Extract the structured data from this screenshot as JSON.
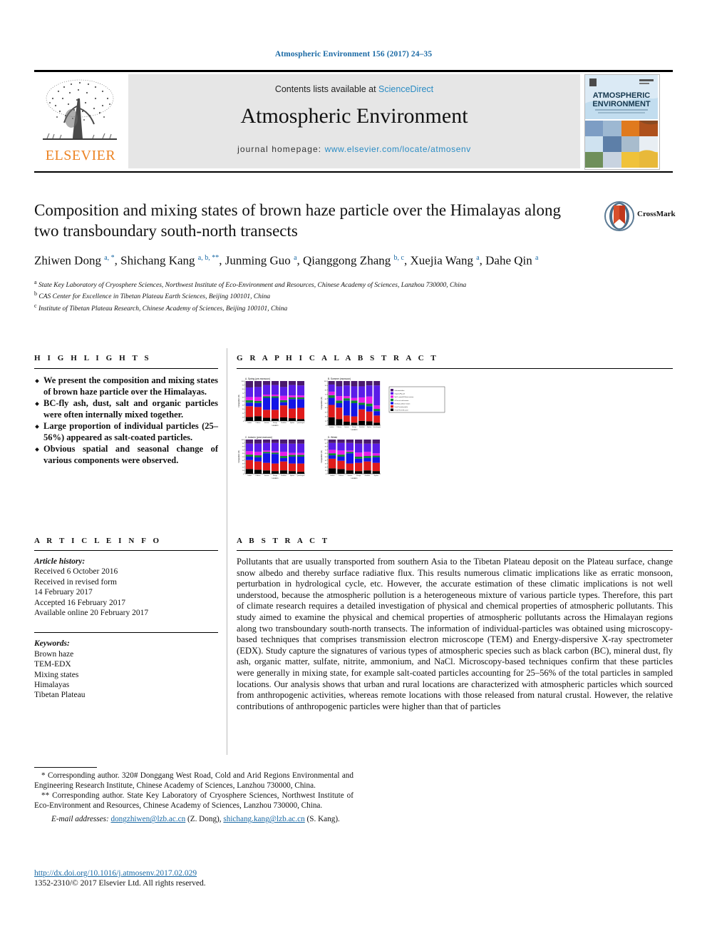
{
  "running_head": "Atmospheric Environment 156 (2017) 24–35",
  "masthead": {
    "contents_line_prefix": "Contents lists available at ",
    "sciencedirect": "ScienceDirect",
    "journal_title": "Atmospheric Environment",
    "homepage_label": "journal homepage:",
    "homepage_url": "www.elsevier.com/locate/atmosenv",
    "publisher": "ELSEVIER",
    "cover_title_line1": "ATMOSPHERIC",
    "cover_title_line2": "ENVIRONMENT"
  },
  "article": {
    "title": "Composition and mixing states of brown haze particle over the Himalayas along two transboundary south-north transects",
    "crossmark_label": "CrossMark",
    "authors_html": "Zhiwen Dong <sup class=\"aff-mark\">a, *</sup>, Shichang Kang <sup class=\"aff-mark\">a, b, **</sup>, Junming Guo <sup class=\"aff-mark\">a</sup>, Qianggong Zhang <sup class=\"aff-mark\">b, c</sup>, Xuejia Wang <sup class=\"aff-mark\">a</sup>, Dahe Qin <sup class=\"aff-mark\">a</sup>",
    "affiliations": [
      {
        "mark": "a",
        "text": "State Key Laboratory of Cryosphere Sciences, Northwest Institute of Eco-Environment and Resources, Chinese Academy of Sciences, Lanzhou 730000, China"
      },
      {
        "mark": "b",
        "text": "CAS Center for Excellence in Tibetan Plateau Earth Sciences, Beijing 100101, China"
      },
      {
        "mark": "c",
        "text": "Institute of Tibetan Plateau Research, Chinese Academy of Sciences, Beijing 100101, China"
      }
    ]
  },
  "highlights": {
    "heading": "H I G H L I G H T S",
    "items": [
      "We present the composition and mixing states of brown haze particle over the Himalayas.",
      "BC-fly ash, dust, salt and organic particles were often internally mixed together.",
      "Large proportion of individual particles (25–56%) appeared as salt-coated particles.",
      "Obvious spatial and seasonal change of various components were observed."
    ]
  },
  "graphical_abstract": {
    "heading": "G R A P H I C A L   A B S T R A C T"
  },
  "article_info": {
    "heading": "A R T I C L E   I N F O",
    "history_label": "Article history:",
    "history": [
      "Received 6 October 2016",
      "Received in revised form",
      "14 February 2017",
      "Accepted 16 February 2017",
      "Available online 20 February 2017"
    ],
    "keywords_label": "Keywords:",
    "keywords": [
      "Brown haze",
      "TEM-EDX",
      "Mixing states",
      "Himalayas",
      "Tibetan Plateau"
    ]
  },
  "abstract": {
    "heading": "A B S T R A C T",
    "text": "Pollutants that are usually transported from southern Asia to the Tibetan Plateau deposit on the Plateau surface, change snow albedo and thereby surface radiative flux. This results numerous climatic implications like as erratic monsoon, perturbation in hydrological cycle, etc. However, the accurate estimation of these climatic implications is not well understood, because the atmospheric pollution is a heterogeneous mixture of various particle types. Therefore, this part of climate research requires a detailed investigation of physical and chemical properties of atmospheric pollutants. This study aimed to examine the physical and chemical properties of atmospheric pollutants across the Himalayan regions along two transboundary south-north transects. The information of individual-particles was obtained using microscopy-based techniques that comprises transmission electron microscope (TEM) and Energy-dispersive X-ray spectrometer (EDX). Study capture the signatures of various types of atmospheric species such as black carbon (BC), mineral dust, fly ash, organic matter, sulfate, nitrite, ammonium, and NaCl. Microscopy-based techniques confirm that these particles were generally in mixing state, for example salt-coated particles accounting for 25–56% of the total particles in sampled locations. Our analysis shows that urban and rural locations are characterized with atmospheric particles which sourced from anthropogenic activities, whereas remote locations with those released from natural crustal. However, the relative contributions of anthropogenic particles were higher than that of particles"
  },
  "footnotes": {
    "note1": "* Corresponding author. 320# Donggang West Road, Cold and Arid Regions Environmental and Engineering Research Institute, Chinese Academy of Sciences, Lanzhou 730000, China.",
    "note2": "** Corresponding author. State Key Laboratory of Cryosphere Sciences, Northwest Institute of Eco-Environment and Resources, Chinese Academy of Sciences, Lanzhou 730000, China.",
    "email_label": "E-mail addresses:",
    "email1": "dongzhiwen@lzb.ac.cn",
    "email1_attrib": "(Z. Dong),",
    "email2": "shichang.kang@lzb.ac.cn",
    "email2_attrib": "(S. Kang)."
  },
  "doi_block": {
    "doi": "http://dx.doi.org/10.1016/j.atmosenv.2017.02.029",
    "copyright": "1352-2310/© 2017 Elsevier Ltd. All rights reserved."
  },
  "colors": {
    "link_blue": "#2b8cc4",
    "head_blue": "#1b6aa5",
    "elsevier_orange": "#ec8424",
    "band_grey": "#e6e6e6"
  },
  "chart_data": [
    {
      "type": "bar",
      "id": "panel-a",
      "title": "A. Spring (pre-monsoon)",
      "xlabel": "Location",
      "ylabel": "Composition (%)",
      "ylim": [
        0,
        100
      ],
      "categories": [
        "Lumbini",
        "Pokhara",
        "Jomsom",
        "Dhunge",
        "Dhulikhel",
        "Nyalam",
        "Qomolangma"
      ],
      "series": [
        {
          "name": "Fresh/Thick BC-soot",
          "color": "#000000",
          "values": [
            10,
            12,
            8,
            6,
            9,
            7,
            5
          ]
        },
        {
          "name": "Dust/Crustal particle",
          "color": "#e01b1b",
          "values": [
            27,
            23,
            20,
            22,
            30,
            24,
            28
          ]
        },
        {
          "name": "BC/Soot-sulfate mixture",
          "color": "#1414e6",
          "values": [
            9,
            10,
            30,
            30,
            8,
            24,
            22
          ]
        },
        {
          "name": "K/Ca-rich salt mixture",
          "color": "#0d8a2e",
          "values": [
            6,
            5,
            4,
            4,
            5,
            4,
            4
          ]
        },
        {
          "name": "NaCl coated BC/dust",
          "color": "#e81ce8",
          "values": [
            8,
            10,
            4,
            4,
            11,
            5,
            5
          ]
        },
        {
          "name": "Organic/Fly-ash",
          "color": "#5a1ce8",
          "values": [
            24,
            25,
            24,
            24,
            22,
            26,
            25
          ]
        },
        {
          "name": "Unknown/other",
          "color": "#4b1a6e",
          "values": [
            16,
            15,
            10,
            10,
            15,
            10,
            11
          ]
        }
      ]
    },
    {
      "type": "bar",
      "id": "panel-b",
      "title": "B. Summer (monsoon)",
      "xlabel": "Location",
      "ylabel": "Composition (%)",
      "ylim": [
        0,
        100
      ],
      "categories": [
        "Lumbini",
        "Pokhara",
        "Jomsom",
        "Dhunge",
        "Dhulikhel",
        "Nyalam",
        "Qomolangma"
      ],
      "series": [
        {
          "name": "Fresh/Thick BC-soot",
          "color": "#000000",
          "values": [
            18,
            14,
            8,
            6,
            10,
            9,
            6
          ]
        },
        {
          "name": "Dust/Crustal particle",
          "color": "#e01b1b",
          "values": [
            28,
            26,
            14,
            14,
            26,
            22,
            16
          ]
        },
        {
          "name": "BC/Soot-sulfate mixture",
          "color": "#1414e6",
          "values": [
            16,
            10,
            34,
            30,
            10,
            12,
            10
          ]
        },
        {
          "name": "K/Ca-rich salt mixture",
          "color": "#0d8a2e",
          "values": [
            6,
            6,
            5,
            6,
            5,
            6,
            5
          ]
        },
        {
          "name": "NaCl coated BC/dust",
          "color": "#e81ce8",
          "values": [
            8,
            10,
            5,
            6,
            12,
            16,
            8
          ]
        },
        {
          "name": "Organic/Fly-ash",
          "color": "#5a1ce8",
          "values": [
            16,
            22,
            24,
            26,
            25,
            25,
            45
          ]
        },
        {
          "name": "Unknown/other",
          "color": "#4b1a6e",
          "values": [
            8,
            12,
            10,
            12,
            12,
            10,
            10
          ]
        }
      ]
    },
    {
      "type": "bar",
      "id": "panel-c",
      "title": "C. Autumn (post-monsoon)",
      "xlabel": "Location",
      "ylabel": "Composition (%)",
      "ylim": [
        0,
        100
      ],
      "categories": [
        "Lumbini",
        "Pokhara",
        "Jomsom",
        "Dhunge",
        "Dhulikhel",
        "Nyalam",
        "Qomolangma"
      ],
      "series": [
        {
          "name": "Fresh/Thick BC-soot",
          "color": "#000000",
          "values": [
            14,
            12,
            10,
            8,
            10,
            8,
            6
          ]
        },
        {
          "name": "Dust/Crustal particle",
          "color": "#e01b1b",
          "values": [
            26,
            24,
            22,
            22,
            26,
            22,
            24
          ]
        },
        {
          "name": "BC/Soot-sulfate mixture",
          "color": "#1414e6",
          "values": [
            10,
            12,
            28,
            28,
            10,
            20,
            20
          ]
        },
        {
          "name": "K/Ca-rich salt mixture",
          "color": "#0d8a2e",
          "values": [
            6,
            6,
            4,
            4,
            6,
            5,
            5
          ]
        },
        {
          "name": "NaCl coated BC/dust",
          "color": "#e81ce8",
          "values": [
            10,
            10,
            4,
            4,
            12,
            6,
            6
          ]
        },
        {
          "name": "Organic/Fly-ash",
          "color": "#5a1ce8",
          "values": [
            22,
            24,
            22,
            24,
            24,
            27,
            27
          ]
        },
        {
          "name": "Unknown/other",
          "color": "#4b1a6e",
          "values": [
            12,
            12,
            10,
            10,
            12,
            12,
            12
          ]
        }
      ]
    },
    {
      "type": "bar",
      "id": "panel-d",
      "title": "D. Winter",
      "xlabel": "Location",
      "ylabel": "Composition (%)",
      "ylim": [
        0,
        100
      ],
      "categories": [
        "Lumbini",
        "Pokhara",
        "Jomsom",
        "Dhunge",
        "Dhulikhel",
        "Nyalam"
      ],
      "series": [
        {
          "name": "Fresh/Thick BC-soot",
          "color": "#000000",
          "values": [
            16,
            14,
            10,
            8,
            10,
            8
          ]
        },
        {
          "name": "Dust/Crustal particle",
          "color": "#e01b1b",
          "values": [
            28,
            24,
            20,
            24,
            26,
            24
          ]
        },
        {
          "name": "BC/Soot-sulfate mixture",
          "color": "#1414e6",
          "values": [
            10,
            12,
            30,
            12,
            10,
            16
          ]
        },
        {
          "name": "K/Ca-rich salt mixture",
          "color": "#0d8a2e",
          "values": [
            6,
            6,
            4,
            6,
            6,
            5
          ]
        },
        {
          "name": "NaCl coated BC/dust",
          "color": "#e81ce8",
          "values": [
            10,
            12,
            4,
            12,
            12,
            7
          ]
        },
        {
          "name": "Organic/Fly-ash",
          "color": "#5a1ce8",
          "values": [
            20,
            22,
            22,
            26,
            24,
            28
          ]
        },
        {
          "name": "Unknown/other",
          "color": "#4b1a6e",
          "values": [
            10,
            10,
            10,
            12,
            12,
            12
          ]
        }
      ]
    }
  ],
  "chart_legend": [
    "Unknown/other",
    "Organic/Fly-ash",
    "NaCl coated BC/dust mixture",
    "K/Ca-rich salt mixture",
    "BC/Soot-sulfate mixture",
    "Dust/Crustal particle",
    "Fresh/Thick BC-soot"
  ]
}
